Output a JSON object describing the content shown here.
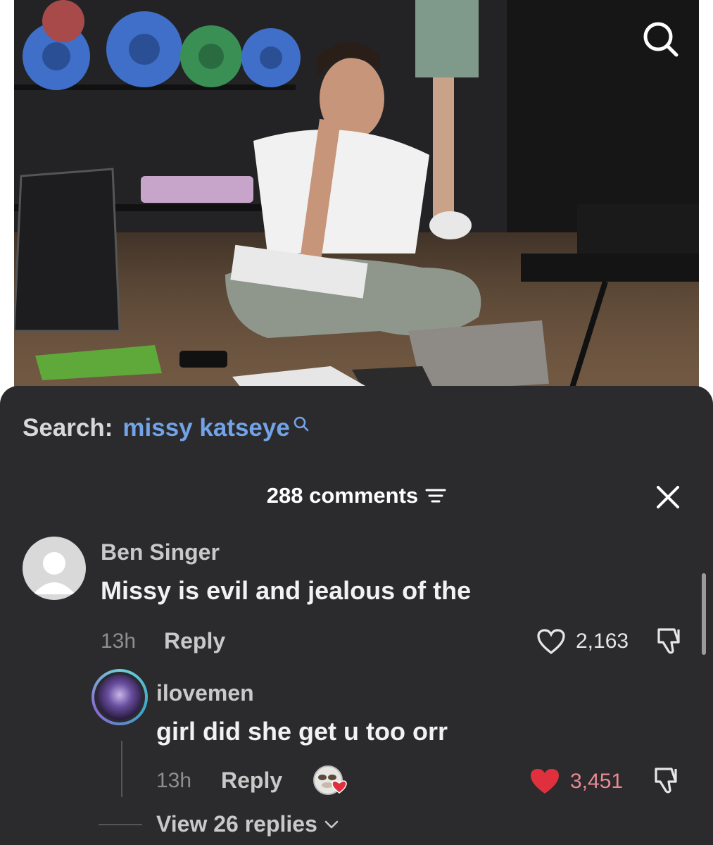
{
  "search": {
    "label": "Search:",
    "term": "missy katseye"
  },
  "comments": {
    "count_label": "288 comments"
  },
  "thread": {
    "comment": {
      "username": "Ben Singer",
      "text": "Missy is evil and jealous of the",
      "time": "13h",
      "reply_label": "Reply",
      "likes": "2,163",
      "liked": false
    },
    "reply": {
      "username": "ilovemen",
      "text": "girl did she get u too orr",
      "time": "13h",
      "reply_label": "Reply",
      "likes": "3,451",
      "liked": true,
      "liked_by_creator": true
    },
    "view_replies_label": "View 26 replies"
  },
  "icons": {
    "top_right": "search-icon",
    "sort": "sort-icon",
    "close": "close-icon",
    "like": "heart-icon",
    "dislike": "dislike-icon",
    "expand": "chevron-down-icon"
  },
  "colors": {
    "sheet_bg": "#2b2b2d",
    "search_term": "#72a3e6",
    "like_red": "#e0303e",
    "liked_count": "#e98a94"
  }
}
